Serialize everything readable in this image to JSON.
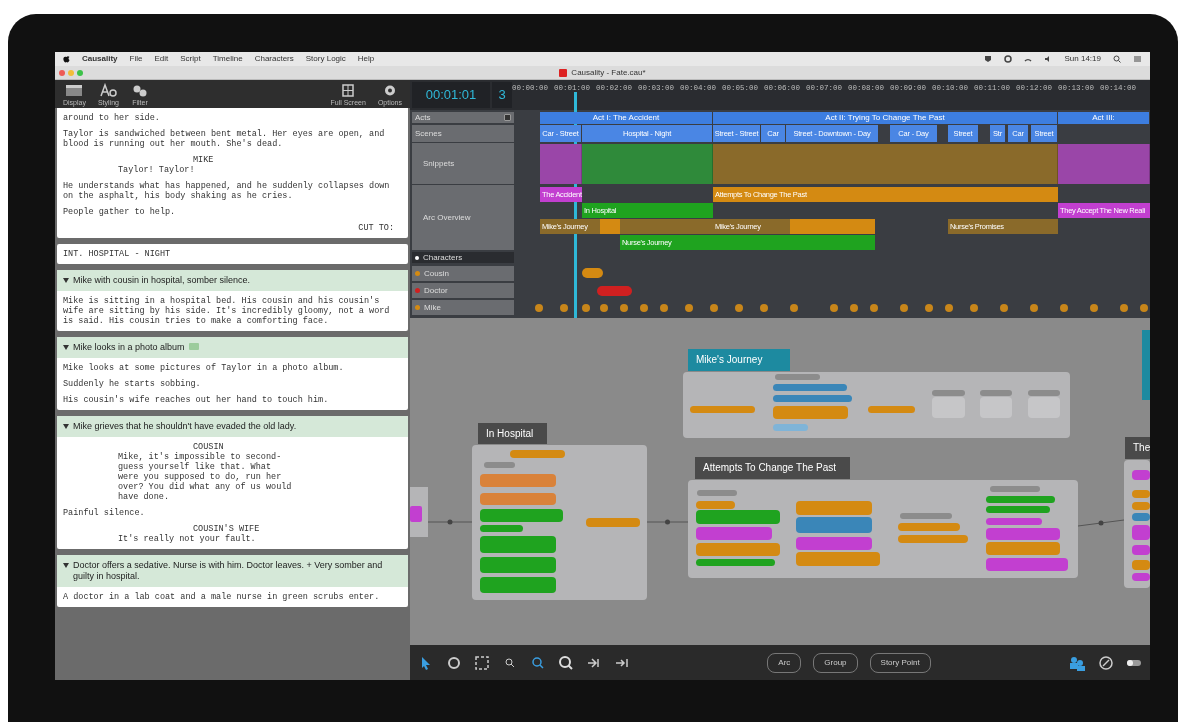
{
  "menu_bar": {
    "app": "Causality",
    "items": [
      "File",
      "Edit",
      "Script",
      "Timeline",
      "Characters",
      "Story Logic",
      "Help"
    ],
    "clock": "Sun 14:19"
  },
  "window": {
    "title": "Causality - Fate.cau*"
  },
  "script_toolbar": [
    {
      "kind": "display",
      "label": "Display"
    },
    {
      "kind": "styling",
      "label": "Styling"
    },
    {
      "kind": "filter",
      "label": "Filter"
    },
    {
      "kind": "fullscreen",
      "label": "Full Screen"
    },
    {
      "kind": "options",
      "label": "Options"
    }
  ],
  "script": [
    {
      "kind": "text",
      "elements": [
        {
          "kind": "action",
          "text": "around to her side."
        },
        {
          "kind": "action",
          "text": "Taylor is sandwiched between bent metal. Her eyes are open, and blood is running out her mouth. She's dead."
        },
        {
          "kind": "character",
          "text": "MIKE"
        },
        {
          "kind": "dialogue",
          "text": "Taylor! Taylor!"
        },
        {
          "kind": "action",
          "text": "He understands what has happened, and he suddenly collapses down on the asphalt, his body shaking as he cries."
        },
        {
          "kind": "action",
          "text": "People gather to help."
        },
        {
          "kind": "transition",
          "text": "CUT TO:"
        }
      ]
    },
    {
      "kind": "heading",
      "elements": [
        {
          "kind": "action",
          "text": "INT. HOSPITAL - NIGHT"
        }
      ]
    },
    {
      "kind": "beat",
      "header": "Mike with cousin in hospital, somber silence.",
      "expanded": true,
      "elements": [
        {
          "kind": "action",
          "text": "Mike is sitting in a hospital bed. His cousin and his cousin's wife are sitting by his side. It's incredibly gloomy, not a word is said. His cousin tries to make a comforting face."
        }
      ]
    },
    {
      "kind": "beat",
      "header": "Mike looks in a photo album",
      "badge": true,
      "expanded": true,
      "elements": [
        {
          "kind": "action",
          "text": "Mike looks at some pictures of Taylor in a photo album."
        },
        {
          "kind": "action",
          "text": "Suddenly he starts sobbing."
        },
        {
          "kind": "action",
          "text": "His cousin's wife reaches out her hand to touch him."
        }
      ]
    },
    {
      "kind": "beat",
      "header": "Mike grieves that he shouldn't have evaded the old lady.",
      "expanded": true,
      "elements": [
        {
          "kind": "character",
          "text": "COUSIN"
        },
        {
          "kind": "dialogue",
          "text": "Mike, it's impossible to second-guess yourself like that. What were you supposed to do, run her over? You did what any of us would have done."
        },
        {
          "kind": "action",
          "text": "Painful silence."
        },
        {
          "kind": "character",
          "text": "COUSIN'S WIFE"
        },
        {
          "kind": "dialogue",
          "text": "It's really not your fault."
        }
      ]
    },
    {
      "kind": "beat",
      "header": "Doctor offers a sedative. Nurse is with him. Doctor leaves. + Very somber and guilty in hospital.",
      "expanded": true,
      "elements": [
        {
          "kind": "action",
          "text": "A doctor in a lab coat and a male nurse in green scrubs enter."
        }
      ]
    }
  ],
  "timeline": {
    "time": "00:01:01",
    "count": "3",
    "ticks": [
      "00:00:00",
      "00:01:00",
      "00:02:00",
      "00:03:00",
      "00:04:00",
      "00:05:00",
      "00:06:00",
      "00:07:00",
      "00:08:00",
      "00:09:00",
      "00:10:00",
      "00:11:00",
      "00:12:00",
      "00:13:00",
      "00:14:00"
    ],
    "tracks": [
      {
        "kind": "acts",
        "label": "Acts"
      },
      {
        "kind": "scenes",
        "label": "Scenes"
      },
      {
        "kind": "snippets",
        "label": "Snippets"
      },
      {
        "kind": "arcs",
        "label": "Arc Overview"
      },
      {
        "kind": "header",
        "label": "Characters"
      },
      {
        "kind": "character",
        "label": "Cousin",
        "color": "#d48a12"
      },
      {
        "kind": "character",
        "label": "Doctor",
        "color": "#d02020"
      },
      {
        "kind": "character",
        "label": "Mike",
        "color": "#d48a12"
      }
    ],
    "acts": [
      "Act I: The Accident",
      "Act II: Trying To Change The Past",
      "Act III:"
    ],
    "scenes": [
      "Car - Street",
      "Hospital - Night",
      "Street - Street",
      "Car",
      "Street - Downtown - Day",
      "Car - Day",
      "Street",
      "Str",
      "Car",
      "Street"
    ],
    "arcs": [
      {
        "label": "The Accident",
        "color": "#c23fd0"
      },
      {
        "label": "Attempts To Change The Past",
        "color": "#d48a12"
      },
      {
        "label": "In Hospital",
        "color": "#1fa31f"
      },
      {
        "label": "They Accept The New Reali",
        "color": "#c23fd0"
      },
      {
        "label": "Mike's Journey",
        "color": "#8a6a2a"
      },
      {
        "label": "Mike's Journey",
        "color": "#8a6a2a"
      },
      {
        "label": "Nurse's Promises",
        "color": "#8a6a2a"
      },
      {
        "label": "Nurse's Journey",
        "color": "#1fa31f"
      }
    ]
  },
  "story_graph": {
    "groups": [
      {
        "title": "Mike's Journey",
        "color": "#1d8aa0"
      },
      {
        "title": "In Hospital",
        "color": "#4a4a4a"
      },
      {
        "title": "Attempts To Change The Past",
        "color": "#4a4a4a"
      },
      {
        "title": "The",
        "color": "#4a4a4a"
      }
    ]
  },
  "graph_toolbar": [
    "Arc",
    "Group",
    "Story Point"
  ]
}
